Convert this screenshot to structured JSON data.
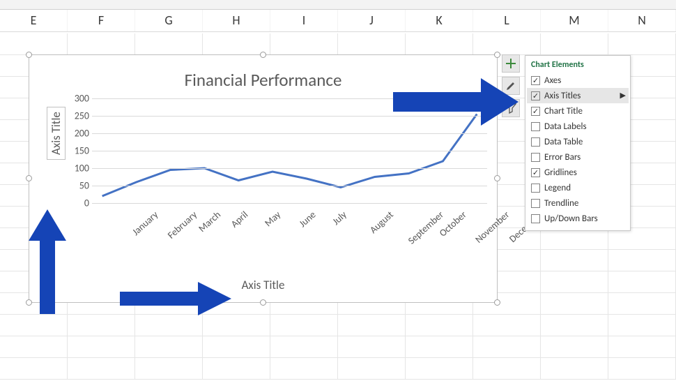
{
  "columns": [
    "E",
    "F",
    "G",
    "H",
    "I",
    "J",
    "K",
    "L",
    "M",
    "N"
  ],
  "chart": {
    "title": "Financial Performance",
    "y_axis_title": "Axis Title",
    "x_axis_title": "Axis Title"
  },
  "chart_data": {
    "type": "line",
    "title": "Financial Performance",
    "xlabel": "Axis Title",
    "ylabel": "Axis Title",
    "categories": [
      "January",
      "February",
      "March",
      "April",
      "May",
      "June",
      "July",
      "August",
      "September",
      "October",
      "November",
      "December"
    ],
    "values": [
      20,
      60,
      95,
      100,
      65,
      90,
      70,
      45,
      75,
      85,
      120,
      255
    ],
    "y_ticks": [
      0,
      50,
      100,
      150,
      200,
      250,
      300
    ],
    "ylim": [
      0,
      300
    ],
    "grid": true,
    "legend": false
  },
  "side_buttons": [
    {
      "name": "chart-elements",
      "glyph": "plus"
    },
    {
      "name": "chart-styles",
      "glyph": "brush"
    },
    {
      "name": "chart-filters",
      "glyph": "funnel"
    }
  ],
  "flyout": {
    "title": "Chart Elements",
    "highlighted": "Axis Titles",
    "items": [
      {
        "label": "Axes",
        "checked": true
      },
      {
        "label": "Axis Titles",
        "checked": true,
        "has_sub": true
      },
      {
        "label": "Chart Title",
        "checked": true
      },
      {
        "label": "Data Labels",
        "checked": false
      },
      {
        "label": "Data Table",
        "checked": false
      },
      {
        "label": "Error Bars",
        "checked": false
      },
      {
        "label": "Gridlines",
        "checked": true
      },
      {
        "label": "Legend",
        "checked": false
      },
      {
        "label": "Trendline",
        "checked": false
      },
      {
        "label": "Up/Down Bars",
        "checked": false
      }
    ]
  }
}
